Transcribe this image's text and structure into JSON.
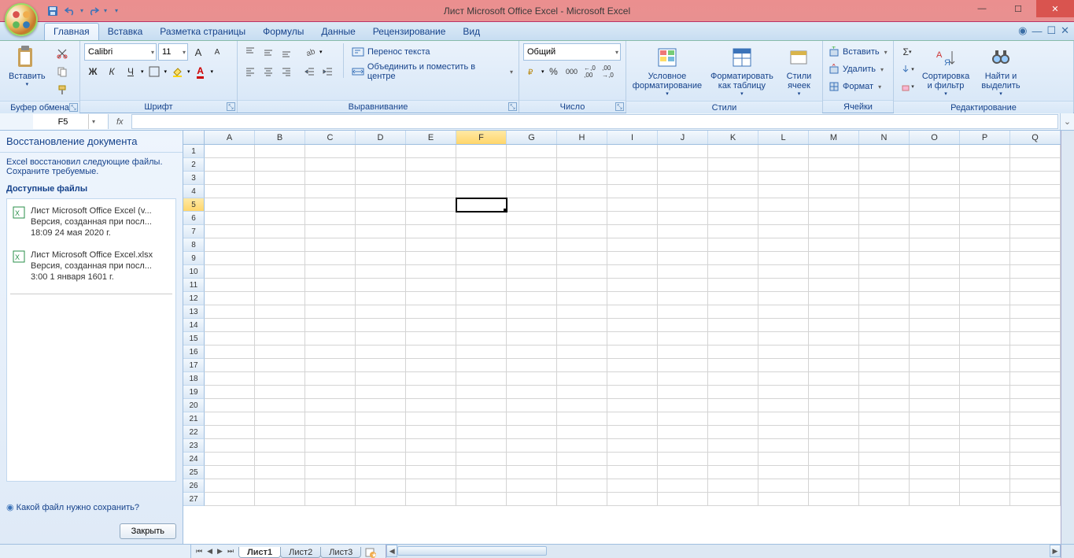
{
  "title": "Лист Microsoft Office Excel - Microsoft Excel",
  "tabs": {
    "home": "Главная",
    "insert": "Вставка",
    "layout": "Разметка страницы",
    "formulas": "Формулы",
    "data": "Данные",
    "review": "Рецензирование",
    "view": "Вид"
  },
  "groups": {
    "clipboard": "Буфер обмена",
    "font": "Шрифт",
    "align": "Выравнивание",
    "number": "Число",
    "styles": "Стили",
    "cells": "Ячейки",
    "editing": "Редактирование"
  },
  "clipboard": {
    "paste": "Вставить"
  },
  "font": {
    "name": "Calibri",
    "size": "11",
    "bold": "Ж",
    "italic": "К",
    "underline": "Ч"
  },
  "align": {
    "wrap": "Перенос текста",
    "merge": "Объединить и поместить в центре"
  },
  "number": {
    "format": "Общий"
  },
  "styles": {
    "cond": "Условное форматирование",
    "fmttbl": "Форматировать как таблицу",
    "cellst": "Стили ячеек"
  },
  "cells": {
    "insert": "Вставить",
    "delete": "Удалить",
    "format": "Формат"
  },
  "editing": {
    "sort": "Сортировка и фильтр",
    "find": "Найти и выделить"
  },
  "namebox": "F5",
  "recovery": {
    "title": "Восстановление документа",
    "msg1": "Excel восстановил следующие файлы.",
    "msg2": "Сохраните требуемые.",
    "avail": "Доступные файлы",
    "items": [
      {
        "name": "Лист Microsoft Office Excel (v...",
        "ver": "Версия, созданная при посл...",
        "time": "18:09 24 мая 2020 г."
      },
      {
        "name": "Лист Microsoft Office Excel.xlsx",
        "ver": "Версия, созданная при посл...",
        "time": "3:00 1 января 1601 г."
      }
    ],
    "help": "Какой файл нужно сохранить?",
    "close": "Закрыть"
  },
  "cols": [
    "A",
    "B",
    "C",
    "D",
    "E",
    "F",
    "G",
    "H",
    "I",
    "J",
    "K",
    "L",
    "M",
    "N",
    "O",
    "P",
    "Q"
  ],
  "rowcount": 27,
  "selected": {
    "col": "F",
    "row": 5
  },
  "sheets": {
    "s1": "Лист1",
    "s2": "Лист2",
    "s3": "Лист3"
  }
}
